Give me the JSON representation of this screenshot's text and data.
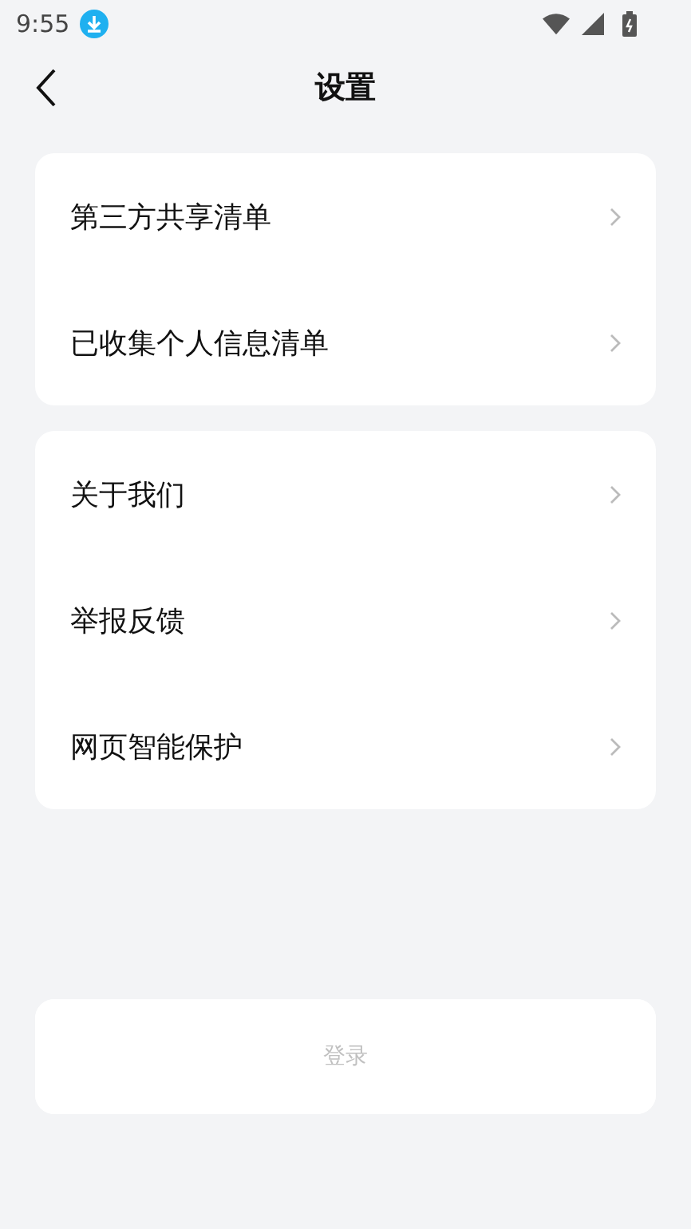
{
  "status_bar": {
    "time": "9:55"
  },
  "header": {
    "title": "设置"
  },
  "groups": [
    {
      "items": [
        {
          "label": "第三方共享清单"
        },
        {
          "label": "已收集个人信息清单"
        }
      ]
    },
    {
      "items": [
        {
          "label": "关于我们"
        },
        {
          "label": "举报反馈"
        },
        {
          "label": "网页智能保护"
        }
      ]
    }
  ],
  "login_button": {
    "label": "登录"
  }
}
